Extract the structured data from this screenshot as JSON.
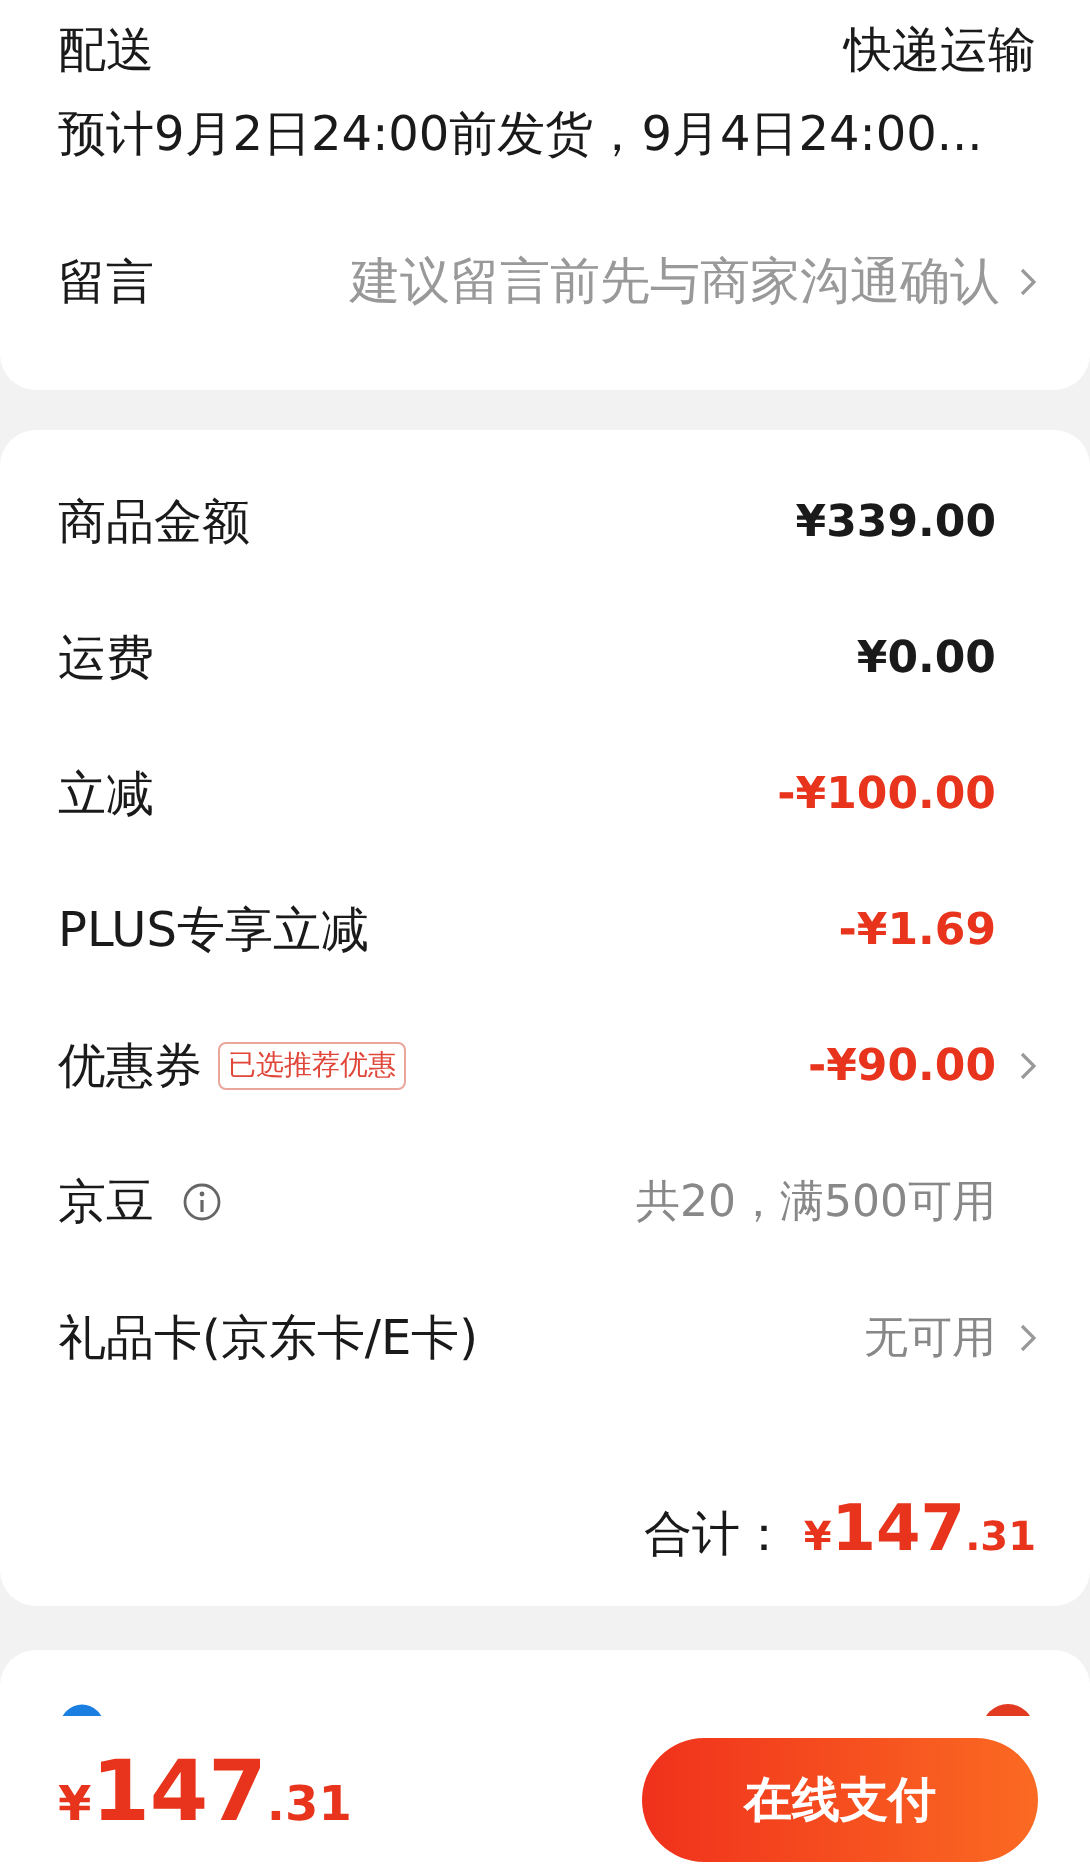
{
  "delivery": {
    "label": "配送",
    "method": "快递运输",
    "note": "预计9月2日24:00前发货，9月4日24:00..."
  },
  "message": {
    "label": "留言",
    "hint": "建议留言前先与商家沟通确认"
  },
  "price_rows": [
    {
      "kind": "amount",
      "label": "商品金额",
      "value": "¥339.00",
      "link": false
    },
    {
      "kind": "amount",
      "label": "运费",
      "value": "¥0.00",
      "link": false
    },
    {
      "kind": "deduction",
      "label": "立减",
      "value": "-¥100.00",
      "link": false
    },
    {
      "kind": "deduction",
      "label": "PLUS专享立减",
      "value": "-¥1.69",
      "link": false
    },
    {
      "kind": "deduction",
      "label": "优惠券",
      "tag": "已选推荐优惠",
      "value": "-¥90.00",
      "link": true
    },
    {
      "kind": "option",
      "label": "京豆",
      "info": true,
      "value": "共20，满500可用",
      "link": false
    },
    {
      "kind": "option",
      "label": "礼品卡(京东卡/E卡)",
      "value": "无可用",
      "link": true
    }
  ],
  "total": {
    "label": "合计：",
    "currency": "¥",
    "integer": "147",
    "decimals": ".31"
  },
  "bottom_bar": {
    "currency": "¥",
    "integer": "147",
    "decimals": ".31",
    "button": "在线支付"
  }
}
